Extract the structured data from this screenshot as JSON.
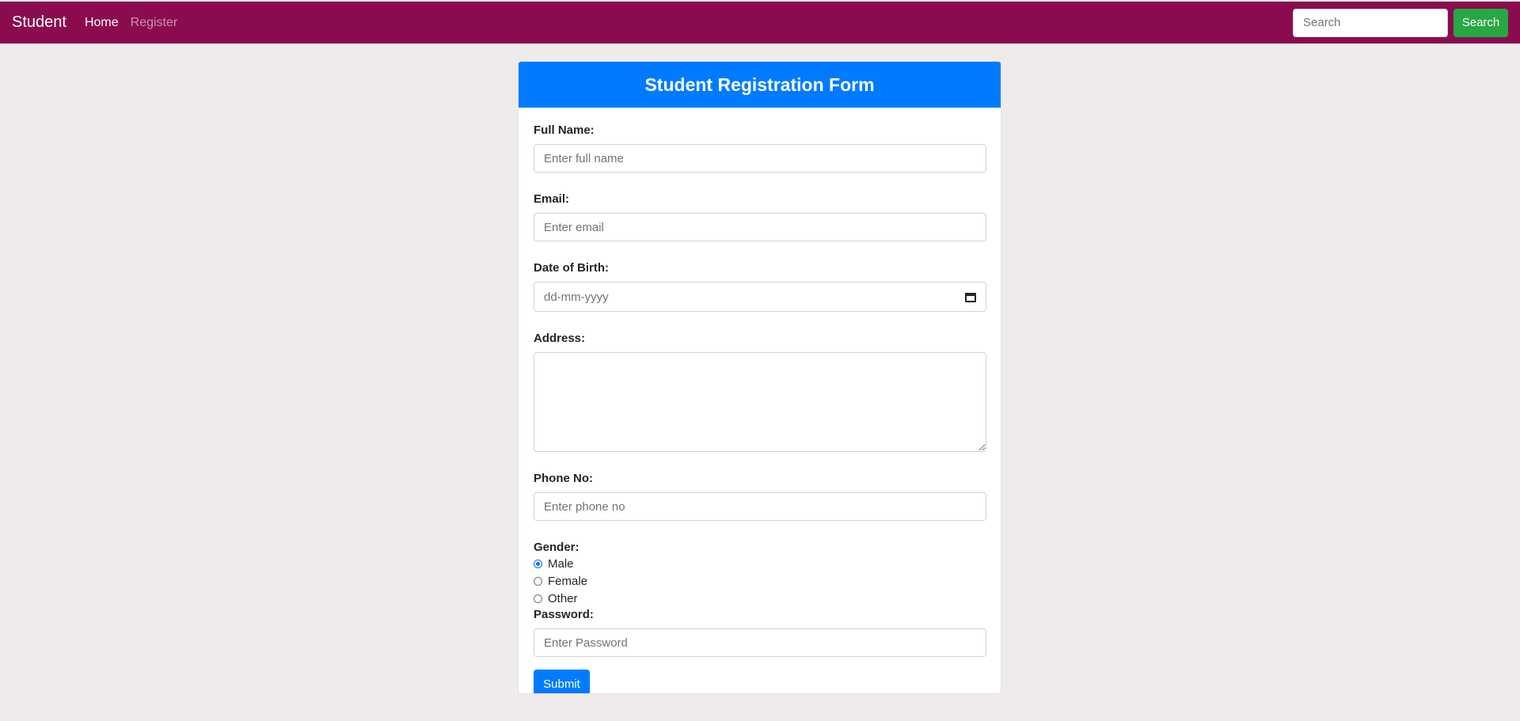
{
  "nav": {
    "brand": "Student",
    "links": [
      {
        "label": "Home",
        "active": true
      },
      {
        "label": "Register",
        "active": false
      }
    ],
    "search_placeholder": "Search",
    "search_button": "Search"
  },
  "form": {
    "title": "Student Registration Form",
    "full_name": {
      "label": "Full Name:",
      "placeholder": "Enter full name"
    },
    "email": {
      "label": "Email:",
      "placeholder": "Enter email"
    },
    "dob": {
      "label": "Date of Birth:",
      "placeholder": "dd-mm-yyyy"
    },
    "address": {
      "label": "Address:"
    },
    "phone": {
      "label": "Phone No:",
      "placeholder": "Enter phone no"
    },
    "gender": {
      "label": "Gender:",
      "options": [
        "Male",
        "Female",
        "Other"
      ],
      "selected": "Male"
    },
    "password": {
      "label": "Password:",
      "placeholder": "Enter Password"
    },
    "submit_label": "Submit"
  },
  "colors": {
    "navbar": "#8a0c4f",
    "header": "#007bff",
    "search_button": "#28a745",
    "page_background": "#f0ebeb"
  }
}
